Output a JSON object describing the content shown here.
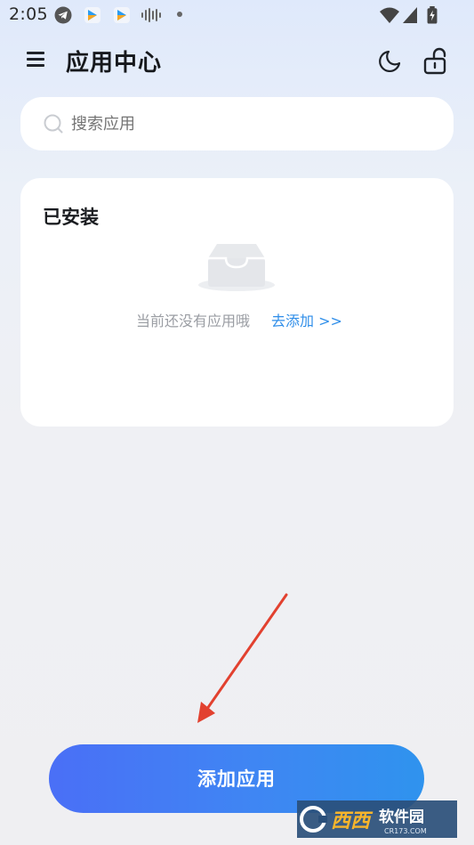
{
  "status_bar": {
    "time": "2:05",
    "icons": [
      "telegram-icon",
      "video-app-icon",
      "video-app-icon",
      "audio-wave-icon",
      "notification-dot",
      "wifi-icon",
      "signal-icon",
      "battery-icon"
    ]
  },
  "header": {
    "title": "应用中心",
    "icons": [
      "menu-icon",
      "moon-icon",
      "unlock-icon"
    ]
  },
  "search": {
    "placeholder": "搜索应用"
  },
  "installed": {
    "title": "已安装",
    "empty_text": "当前还没有应用哦",
    "add_link": "去添加 >>"
  },
  "bottom": {
    "add_button_label": "添加应用"
  },
  "watermark": {
    "brand": "西西",
    "subtitle": "软件园",
    "url": "CR173.COM"
  },
  "colors": {
    "accent": "#2f8ee9",
    "button_gradient_start": "#4a6ff6",
    "button_gradient_end": "#2f93ee",
    "annotation_arrow": "#e2412f"
  }
}
